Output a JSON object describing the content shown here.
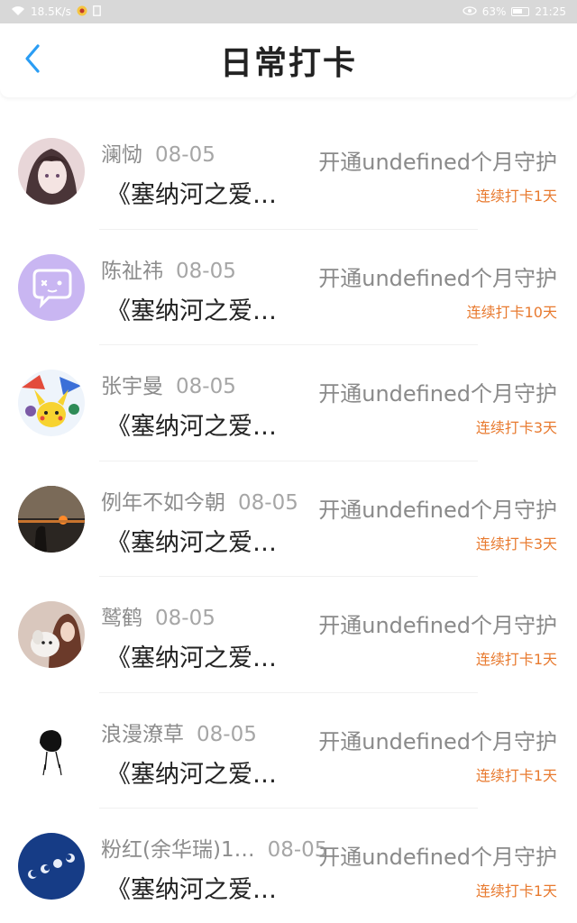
{
  "status_bar": {
    "network_speed": "18.5K/s",
    "battery_percent": "63%",
    "time": "21:25",
    "icons": [
      "wifi-icon",
      "notification-icon",
      "sim-icon",
      "eye-icon",
      "battery-icon"
    ]
  },
  "header": {
    "title": "日常打卡",
    "back_icon": "chevron-left-icon"
  },
  "colors": {
    "accent_back": "#2a9df4",
    "streak": "#e87a2f",
    "secondary_text": "#8c8c8c"
  },
  "list": {
    "items": [
      {
        "name": "澜恸",
        "date": "08-05",
        "content": "《塞纳河之爱…",
        "open": "开通undefined个月守护",
        "streak": "连续打卡1天",
        "avatar": "anime-girl-avatar"
      },
      {
        "name": "陈祉祎",
        "date": "08-05",
        "content": "《塞纳河之爱…",
        "open": "开通undefined个月守护",
        "streak": "连续打卡10天",
        "avatar": "chat-bubble-avatar"
      },
      {
        "name": "张宇曼",
        "date": "08-05",
        "content": "《塞纳河之爱…",
        "open": "开通undefined个月守护",
        "streak": "连续打卡3天",
        "avatar": "pokemon-avatar"
      },
      {
        "name": "例年不如今朝",
        "date": "08-05",
        "content": "《塞纳河之爱…",
        "open": "开通undefined个月守护",
        "streak": "连续打卡3天",
        "avatar": "sunset-avatar"
      },
      {
        "name": "鹫鹤",
        "date": "08-05",
        "content": "《塞纳河之爱…",
        "open": "开通undefined个月守护",
        "streak": "连续打卡1天",
        "avatar": "girl-with-dog-avatar"
      },
      {
        "name": "浪漫潦草",
        "date": "08-05",
        "content": "《塞纳河之爱…",
        "open": "开通undefined个月守护",
        "streak": "连续打卡1天",
        "avatar": "sketch-person-avatar"
      },
      {
        "name": "粉红(余华瑞)1…",
        "date": "08-05",
        "content": "《塞纳河之爱…",
        "open": "开通undefined个月守护",
        "streak": "连续打卡1天",
        "avatar": "moon-phases-avatar"
      }
    ]
  }
}
